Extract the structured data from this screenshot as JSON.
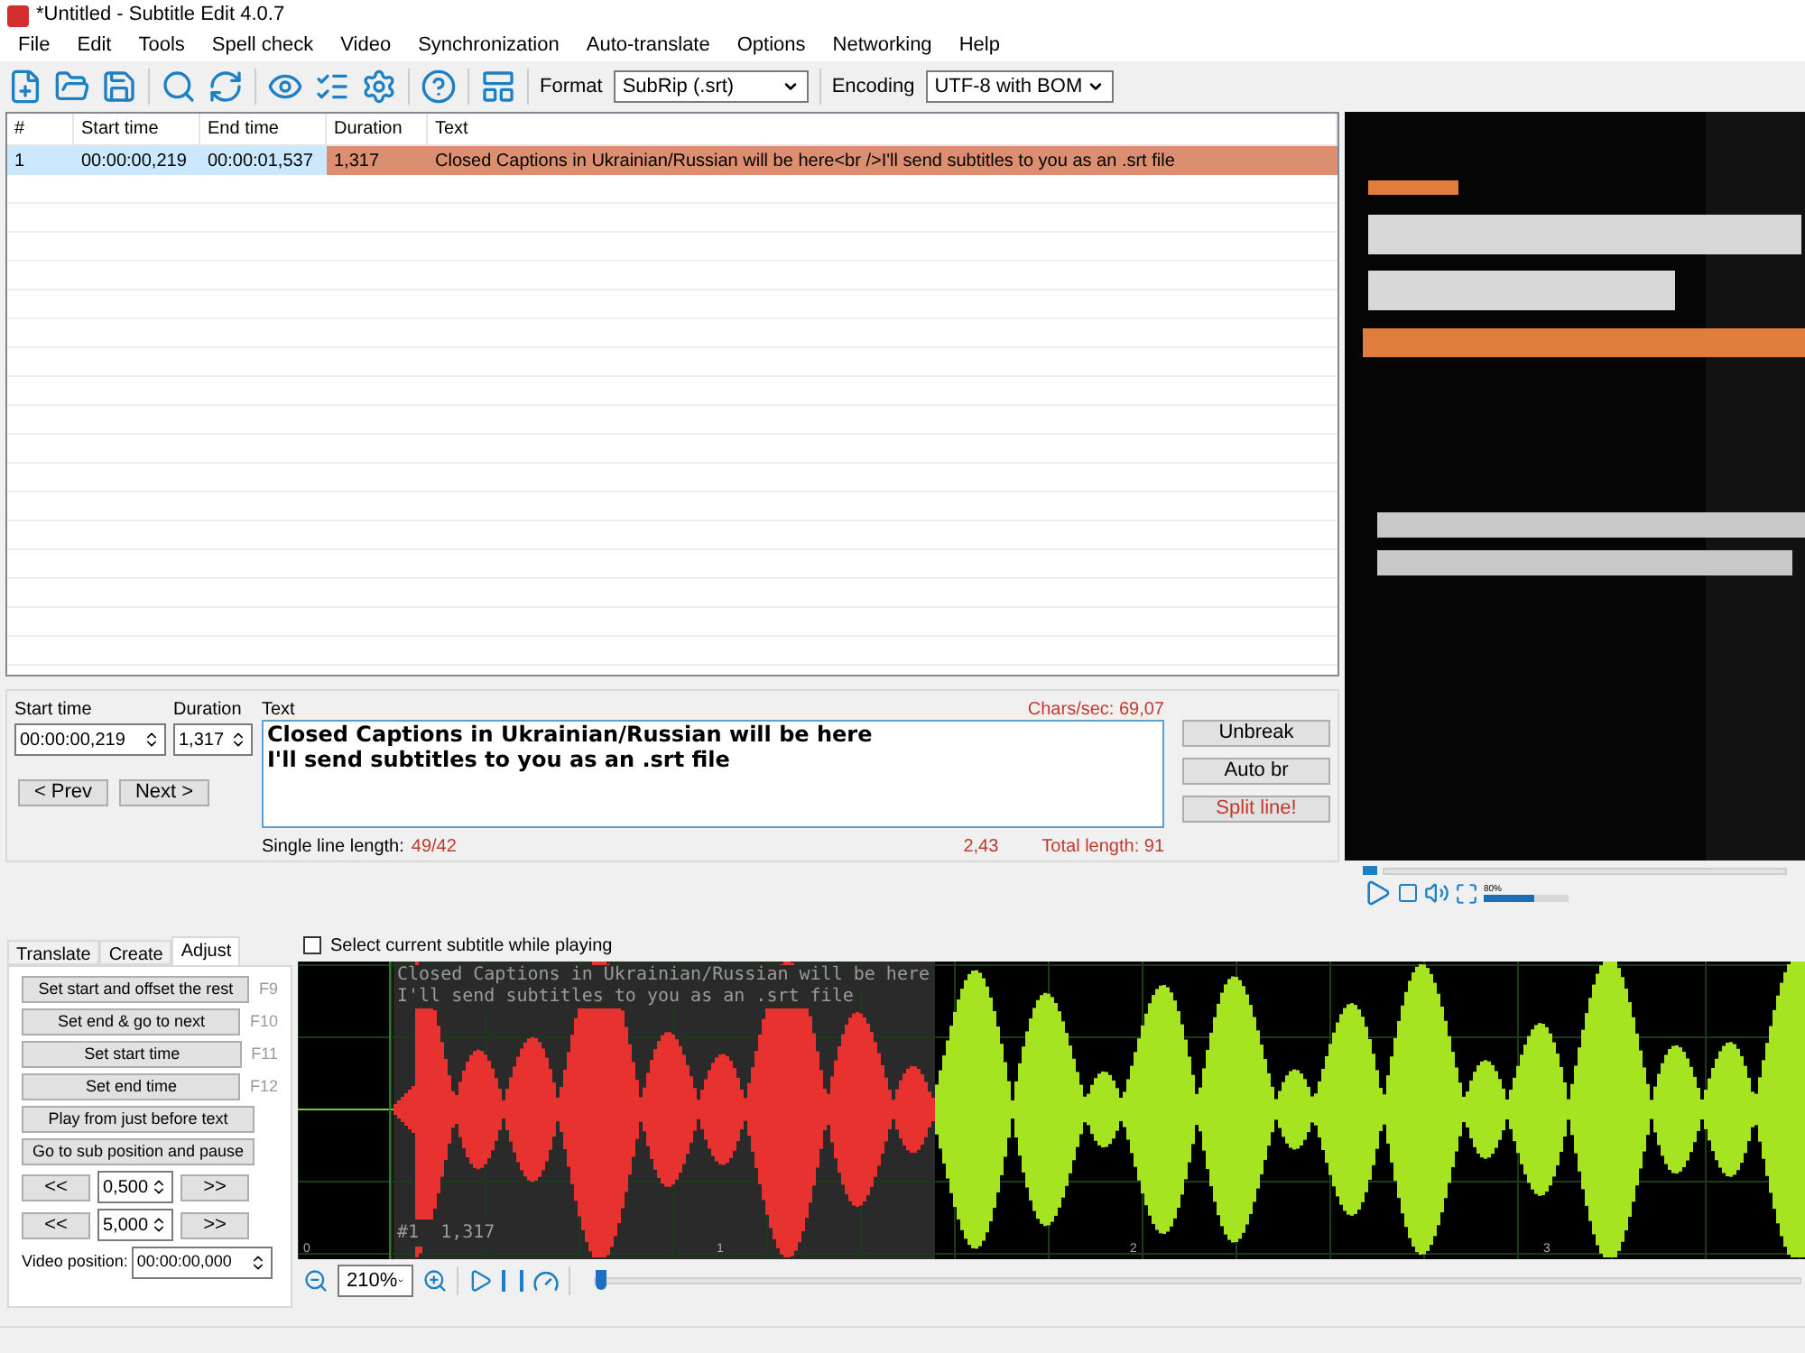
{
  "window": {
    "title": "*Untitled - Subtitle Edit 4.0.7"
  },
  "menu": [
    "File",
    "Edit",
    "Tools",
    "Spell check",
    "Video",
    "Synchronization",
    "Auto-translate",
    "Options",
    "Networking",
    "Help"
  ],
  "toolbar": {
    "format_label": "Format",
    "format_value": "SubRip (.srt)",
    "encoding_label": "Encoding",
    "encoding_value": "UTF-8 with BOM"
  },
  "table": {
    "columns": [
      "#",
      "Start time",
      "End time",
      "Duration",
      "Text"
    ],
    "rows": [
      {
        "number": "1",
        "start": "00:00:00,219",
        "end": "00:00:01,537",
        "duration": "1,317",
        "text": "Closed Captions in Ukrainian/Russian will be here<br />I'll send subtitles to you as an .srt file",
        "selected": true,
        "too_long": true
      }
    ]
  },
  "editor": {
    "start_label": "Start time",
    "start_value": "00:00:00,219",
    "duration_label": "Duration",
    "duration_value": "1,317",
    "text_label": "Text",
    "chars_sec": "Chars/sec: 69,07",
    "lines": [
      "Closed Captions in Ukrainian/Russian will be here",
      "I'll send subtitles to you as an .srt file"
    ],
    "prev": "< Prev",
    "next": "Next >",
    "single_label": "Single line length:",
    "single_value": "49/42",
    "cps_value": "2,43",
    "total_length": "Total length: 91",
    "buttons": [
      {
        "label": "Unbreak",
        "kind": "normal"
      },
      {
        "label": "Auto br",
        "kind": "normal"
      },
      {
        "label": "Split line!",
        "kind": "warning"
      }
    ]
  },
  "video": {
    "kind": "picture",
    "volume_reading": "80%",
    "volume": {
      "level": 0.6
    }
  },
  "tabs": [
    {
      "label": "Translate",
      "selected": false
    },
    {
      "label": "Create",
      "selected": false
    },
    {
      "label": "Adjust",
      "selected": true
    }
  ],
  "adjust": {
    "buttons": [
      {
        "label": "Set start and offset the rest",
        "shortcut": "F9"
      },
      {
        "label": "Set end & go to next",
        "shortcut": "F10"
      },
      {
        "label": "Set start time",
        "shortcut": "F11"
      },
      {
        "label": "Set end time",
        "shortcut": "F12"
      },
      {
        "label": "Play from just before text"
      },
      {
        "label": "Go to sub position and pause"
      }
    ],
    "steppers": [
      {
        "back": "<<",
        "value": "0,500",
        "forward": ">>"
      },
      {
        "back": "<<",
        "value": "5,000",
        "forward": ">>"
      }
    ],
    "video_position_label": "Video position:",
    "video_position_value": "00:00:00,000"
  },
  "waveform": {
    "select_current": {
      "label": "Select current subtitle while playing",
      "checked": false
    },
    "subtitle_lines": [
      "Closed Captions in Ukrainian/Russian will be here",
      "I'll send subtitles to you as an .srt file"
    ],
    "subtitle_info": "#1  1,317",
    "ticks": [
      "0",
      "1",
      "2",
      "3"
    ],
    "zoom": "210%",
    "position": {
      "level": 0.0
    }
  }
}
